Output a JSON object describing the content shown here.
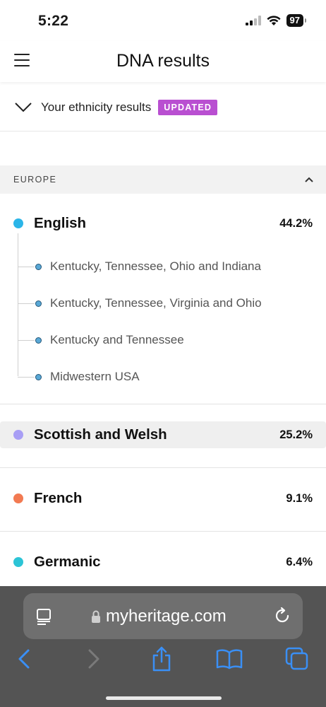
{
  "status_bar": {
    "time": "5:22",
    "battery": "97"
  },
  "header": {
    "title": "DNA results"
  },
  "ethnicity_toggle": {
    "label": "Your ethnicity results",
    "badge": "UPDATED"
  },
  "region": {
    "label": "EUROPE"
  },
  "ethnicities": [
    {
      "name": "English",
      "percent": "44.2%",
      "color": "#2bb5e8"
    },
    {
      "name": "Scottish and Welsh",
      "percent": "25.2%",
      "color": "#a89ef5"
    },
    {
      "name": "French",
      "percent": "9.1%",
      "color": "#f27a52"
    },
    {
      "name": "Germanic",
      "percent": "6.4%",
      "color": "#2cc4d6"
    }
  ],
  "english_subregions": [
    {
      "label": "Kentucky, Tennessee, Ohio and Indiana"
    },
    {
      "label": "Kentucky, Tennessee, Virginia and Ohio"
    },
    {
      "label": "Kentucky and Tennessee"
    },
    {
      "label": "Midwestern USA"
    }
  ],
  "browser": {
    "url": "myheritage.com"
  },
  "colors": {
    "badge": "#b94fd1",
    "accent": "#3a8ff5",
    "browser_bg": "#545454"
  }
}
